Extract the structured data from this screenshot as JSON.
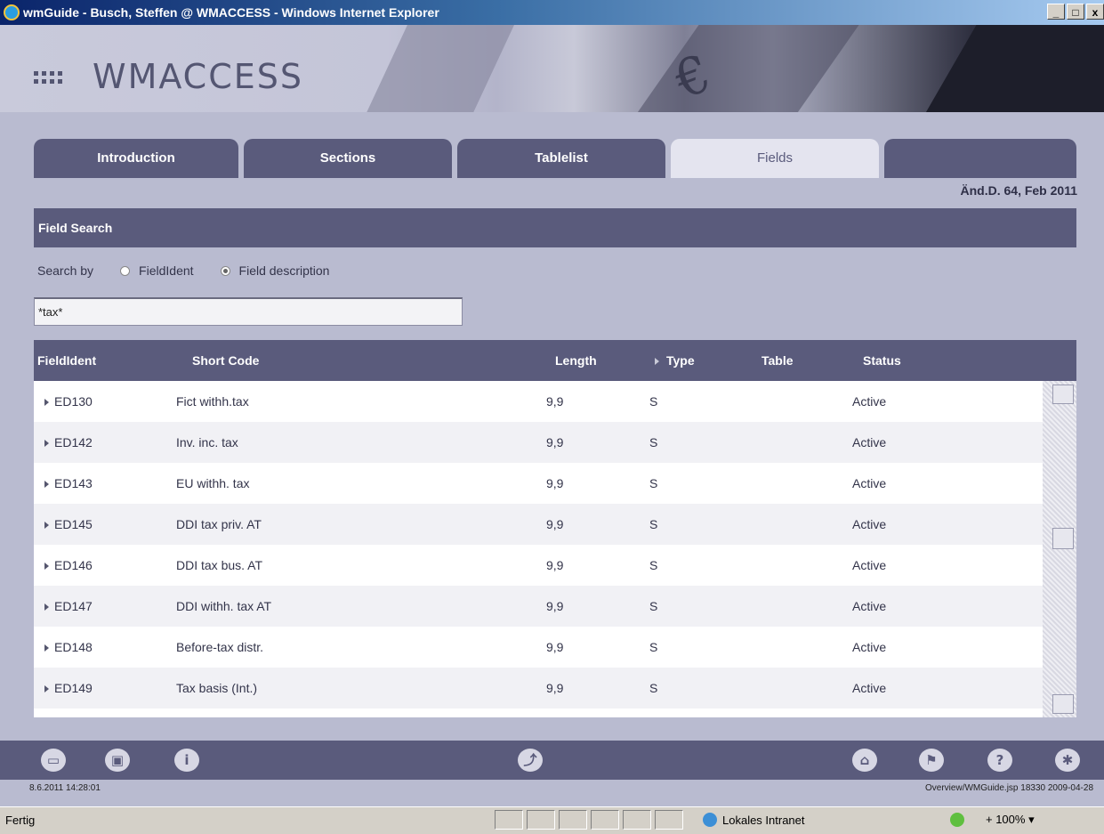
{
  "window": {
    "title": "wmGuide - Busch, Steffen @ WMACCESS - Windows Internet Explorer",
    "minimize": "_",
    "maximize": "□",
    "close": "x"
  },
  "banner": {
    "logo": "WMACCESS",
    "euro": "€"
  },
  "tabs": [
    {
      "label": "Introduction",
      "active": false
    },
    {
      "label": "Sections",
      "active": false
    },
    {
      "label": "Tablelist",
      "active": false
    },
    {
      "label": "Fields",
      "active": true
    }
  ],
  "version": "Änd.D. 64, Feb 2011",
  "search": {
    "header": "Field Search",
    "by_label": "Search by",
    "options": [
      {
        "label": "FieldIdent",
        "selected": false
      },
      {
        "label": "Field description",
        "selected": true
      }
    ],
    "value": "*tax*"
  },
  "table": {
    "columns": [
      "FieldIdent",
      "Short Code",
      "Length",
      "Type",
      "Table",
      "Status"
    ],
    "rows": [
      {
        "ident": "ED130",
        "short": "Fict withh.tax",
        "length": "9,9",
        "type": "S",
        "table": "",
        "status": "Active"
      },
      {
        "ident": "ED142",
        "short": "Inv. inc. tax",
        "length": "9,9",
        "type": "S",
        "table": "",
        "status": "Active"
      },
      {
        "ident": "ED143",
        "short": "EU withh. tax",
        "length": "9,9",
        "type": "S",
        "table": "",
        "status": "Active"
      },
      {
        "ident": "ED145",
        "short": "DDI tax priv. AT",
        "length": "9,9",
        "type": "S",
        "table": "",
        "status": "Active"
      },
      {
        "ident": "ED146",
        "short": "DDI tax bus. AT",
        "length": "9,9",
        "type": "S",
        "table": "",
        "status": "Active"
      },
      {
        "ident": "ED147",
        "short": "DDI withh. tax AT",
        "length": "9,9",
        "type": "S",
        "table": "",
        "status": "Active"
      },
      {
        "ident": "ED148",
        "short": "Before-tax distr.",
        "length": "9,9",
        "type": "S",
        "table": "",
        "status": "Active"
      },
      {
        "ident": "ED149",
        "short": "Tax basis (Int.)",
        "length": "9,9",
        "type": "S",
        "table": "",
        "status": "Active"
      }
    ]
  },
  "toolbar": {
    "icons": [
      "print-icon",
      "copy-icon",
      "info-icon",
      "export-icon",
      "home-icon",
      "flag-icon",
      "help-icon",
      "settings-icon"
    ],
    "glyphs": [
      "▭",
      "▣",
      "i",
      "⤴",
      "⌂",
      "⚑",
      "?",
      "✱"
    ]
  },
  "footer": {
    "datetime": "8.6.2011 14:28:01",
    "info": "Overview/WMGuide.jsp 18330 2009-04-28"
  },
  "statusbar": {
    "text": "Fertig",
    "zone": "Lokales Intranet",
    "zoom": "+ 100%  ▾"
  }
}
